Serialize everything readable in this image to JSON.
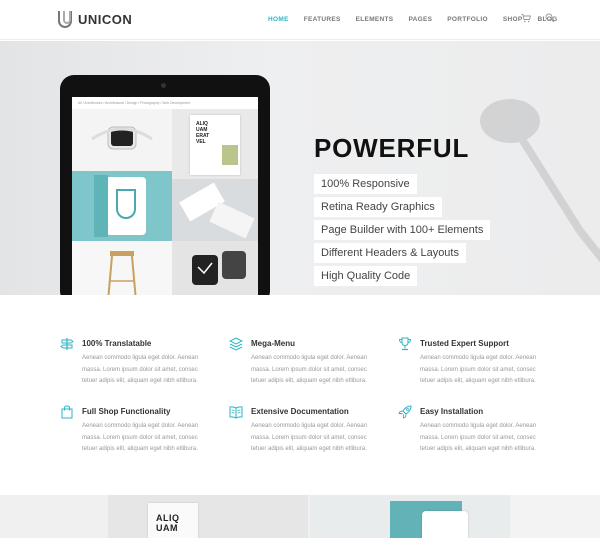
{
  "brand": {
    "name": "UNICON"
  },
  "nav": {
    "items": [
      {
        "label": "HOME",
        "active": true
      },
      {
        "label": "FEATURES",
        "active": false
      },
      {
        "label": "ELEMENTS",
        "active": false
      },
      {
        "label": "PAGES",
        "active": false
      },
      {
        "label": "PORTFOLIO",
        "active": false
      },
      {
        "label": "SHOP",
        "active": false
      },
      {
        "label": "BLOG",
        "active": false
      }
    ],
    "icons": [
      "cart-icon",
      "search-icon"
    ]
  },
  "hero": {
    "title": "POWERFUL",
    "features": [
      "100% Responsive",
      "Retina Ready Graphics",
      "Page Builder with 100+ Elements",
      "Different Headers & Layouts",
      "High Quality Code"
    ],
    "tablet_screen": {
      "breadcrumb": "All  /  Architecture  /  Architectural  /  Design  /  Photography  /  Web Development",
      "tile_text": "ALIQ\nUAM\nERAT\nVEL"
    }
  },
  "features": [
    {
      "icon": "signpost-icon",
      "title": "100% Translatable",
      "desc": "Aenean commodo ligula eget dolor. Aenean massa. Lorem ipsum dolor sit amet, consec tetuer adipis elit, aliquam eget nibh etlibura."
    },
    {
      "icon": "layers-icon",
      "title": "Mega-Menu",
      "desc": "Aenean commodo ligula eget dolor. Aenean massa. Lorem ipsum dolor sit amet, consec tetuer adipis elit, aliquam eget nibh etlibura."
    },
    {
      "icon": "trophy-icon",
      "title": "Trusted Expert Support",
      "desc": "Aenean commodo ligula eget dolor. Aenean massa. Lorem ipsum dolor sit amet, consec tetuer adipis elit, aliquam eget nibh etlibura."
    },
    {
      "icon": "shopping-bag-icon",
      "title": "Full Shop Functionality",
      "desc": "Aenean commodo ligula eget dolor. Aenean massa. Lorem ipsum dolor sit amet, consec tetuer adipis elit, aliquam eget nibh etlibura."
    },
    {
      "icon": "book-icon",
      "title": "Extensive Documentation",
      "desc": "Aenean commodo ligula eget dolor. Aenean massa. Lorem ipsum dolor sit amet, consec tetuer adipis elit, aliquam eget nibh etlibura."
    },
    {
      "icon": "rocket-icon",
      "title": "Easy Installation",
      "desc": "Aenean commodo ligula eget dolor. Aenean massa. Lorem ipsum dolor sit amet, consec tetuer adipis elit, aliquam eget nibh etlibura."
    }
  ],
  "bottom": {
    "preview_text": "ALIQ\nUAM"
  },
  "colors": {
    "accent": "#2bb6c4",
    "teal": "#62b3b7",
    "text": "#333333",
    "muted": "#999999"
  }
}
